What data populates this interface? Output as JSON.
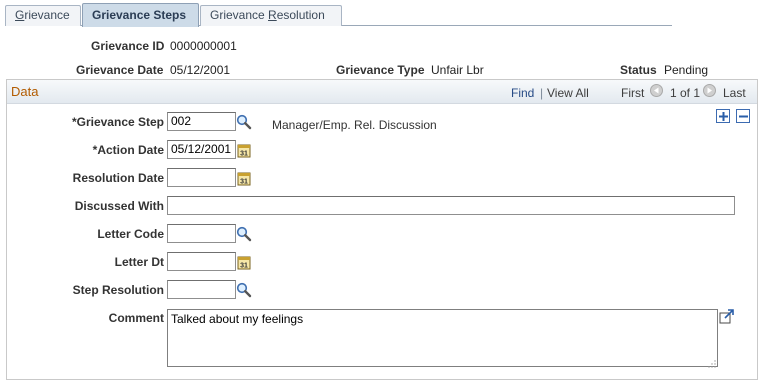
{
  "tabs": [
    {
      "label_pre": "",
      "label_u": "G",
      "label_post": "rievance",
      "active": false
    },
    {
      "label": "Grievance Steps",
      "active": true
    },
    {
      "label_pre": "Grievance ",
      "label_u": "R",
      "label_post": "esolution",
      "active": false
    }
  ],
  "header": {
    "grievance_id_label": "Grievance ID",
    "grievance_id": "0000000001",
    "grievance_date_label": "Grievance Date",
    "grievance_date": "05/12/2001",
    "grievance_type_label": "Grievance Type",
    "grievance_type": "Unfair Lbr",
    "status_label": "Status",
    "status": "Pending"
  },
  "data_box": {
    "title": "Data",
    "find": "Find",
    "separator": "|",
    "view_all": "View All",
    "first": "First",
    "count": "1 of 1",
    "last": "Last"
  },
  "form": {
    "grievance_step_label": "*Grievance Step",
    "grievance_step_value": "002",
    "grievance_step_desc": "Manager/Emp. Rel. Discussion",
    "action_date_label": "*Action Date",
    "action_date_value": "05/12/2001",
    "resolution_date_label": "Resolution Date",
    "resolution_date_value": "",
    "discussed_with_label": "Discussed With",
    "discussed_with_value": "",
    "letter_code_label": "Letter Code",
    "letter_code_value": "",
    "letter_dt_label": "Letter Dt",
    "letter_dt_value": "",
    "step_resolution_label": "Step Resolution",
    "step_resolution_value": "",
    "comment_label": "Comment",
    "comment_value": "Talked about my feelings"
  },
  "icons": {
    "lookup": "magnifier-icon",
    "calendar": "calendar-icon",
    "calendar_text": "31",
    "add": "plus-icon",
    "delete": "minus-icon",
    "expand": "expand-popup-icon"
  },
  "colors": {
    "tab_active_bg": "#cddbe8",
    "data_title": "#b25b00",
    "link": "#264a85",
    "row_button_border": "#3c6bb1"
  }
}
